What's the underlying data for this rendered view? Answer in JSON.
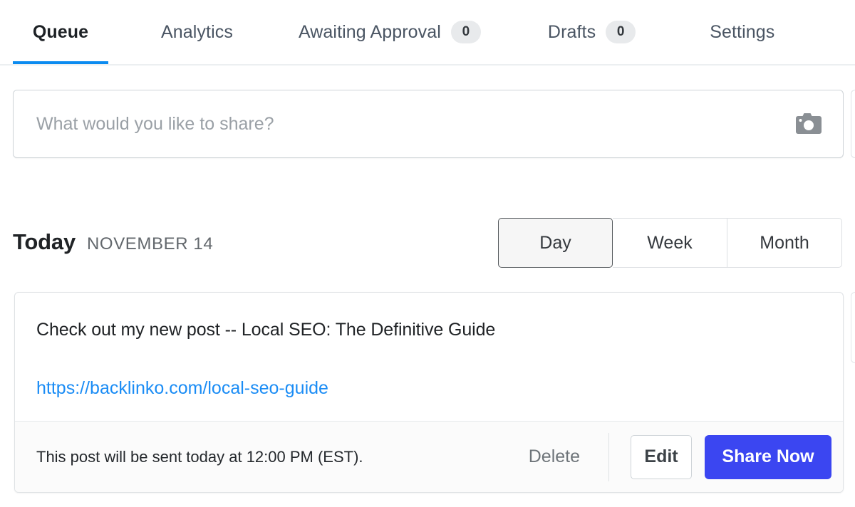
{
  "tabs": [
    {
      "id": "queue",
      "label": "Queue",
      "active": true,
      "badge": null
    },
    {
      "id": "analytics",
      "label": "Analytics",
      "active": false,
      "badge": null
    },
    {
      "id": "awaiting",
      "label": "Awaiting Approval",
      "active": false,
      "badge": "0"
    },
    {
      "id": "drafts",
      "label": "Drafts",
      "active": false,
      "badge": "0"
    },
    {
      "id": "settings",
      "label": "Settings",
      "active": false,
      "badge": null
    }
  ],
  "composer": {
    "placeholder": "What would you like to share?",
    "value": "",
    "camera_icon": "camera-icon"
  },
  "day_header": {
    "today_label": "Today",
    "date_label": "NOVEMBER 14"
  },
  "range_selector": {
    "options": [
      "Day",
      "Week",
      "Month"
    ],
    "selected": "Day"
  },
  "post": {
    "text": "Check out my new post -- Local SEO: The Definitive Guide",
    "link": "https://backlinko.com/local-seo-guide",
    "status": "This post will be sent today at 12:00 PM (EST).",
    "delete_label": "Delete",
    "edit_label": "Edit",
    "share_label": "Share Now"
  },
  "colors": {
    "accent_underline": "#0b8bf0",
    "link": "#1a8cf5",
    "share_button": "#3b46f1",
    "badge_bg": "#e8eaec"
  }
}
